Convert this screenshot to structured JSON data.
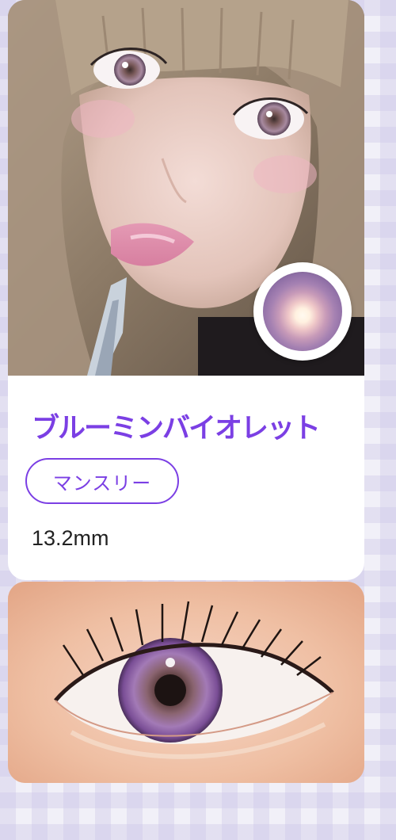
{
  "product": {
    "name": "ブルーミンバイオレット",
    "type": "マンスリー",
    "diameter": "13.2mm"
  },
  "images": {
    "model_photo": "model-wearing-lens-photo",
    "lens_sample": "violet-lens-circle",
    "eye_closeup": "eye-closeup-photo"
  },
  "colors": {
    "accent": "#7b3fe4",
    "card_background": "#ffffff",
    "page_background": "#f1f0f8"
  }
}
